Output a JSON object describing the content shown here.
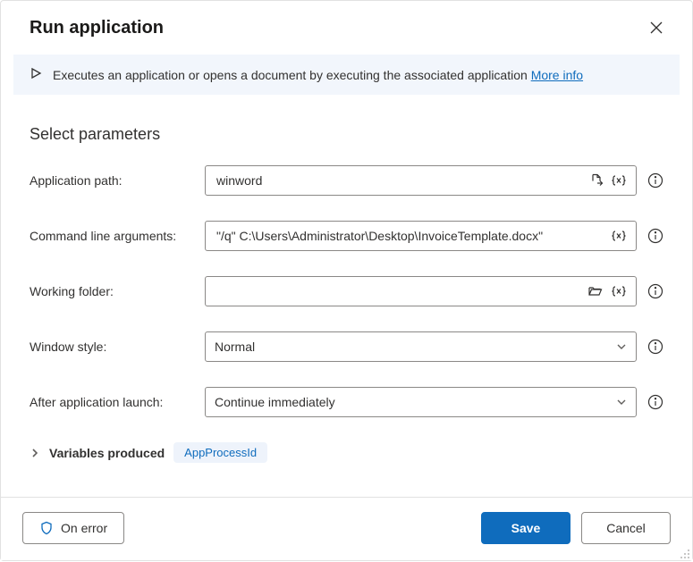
{
  "dialog": {
    "title": "Run application",
    "banner_text": "Executes an application or opens a document by executing the associated application",
    "more_info": "More info"
  },
  "section": {
    "title": "Select parameters"
  },
  "fields": {
    "application_path": {
      "label": "Application path:",
      "value": "winword"
    },
    "command_line_arguments": {
      "label": "Command line arguments:",
      "value": "\"/q\" C:\\Users\\Administrator\\Desktop\\InvoiceTemplate.docx\""
    },
    "working_folder": {
      "label": "Working folder:",
      "value": ""
    },
    "window_style": {
      "label": "Window style:",
      "value": "Normal"
    },
    "after_launch": {
      "label": "After application launch:",
      "value": "Continue immediately"
    }
  },
  "variables": {
    "label": "Variables produced",
    "chip": "AppProcessId"
  },
  "footer": {
    "on_error": "On error",
    "save": "Save",
    "cancel": "Cancel"
  }
}
